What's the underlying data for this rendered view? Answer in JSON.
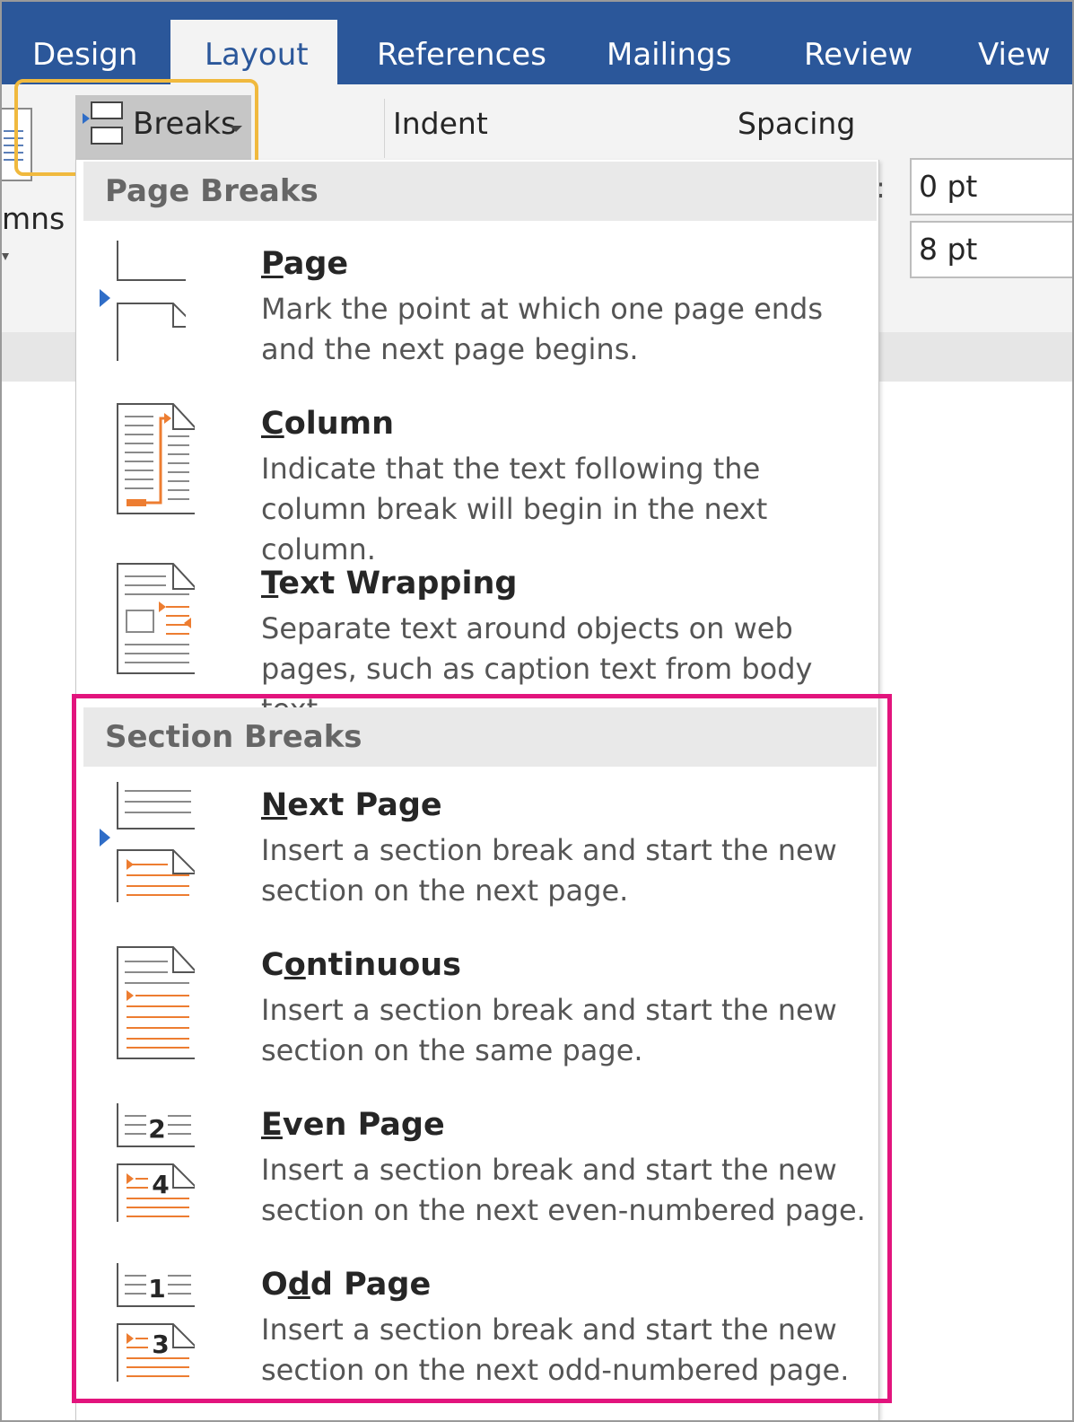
{
  "ribbon": {
    "tabs": [
      {
        "label": "Design",
        "active": false
      },
      {
        "label": "Layout",
        "active": true
      },
      {
        "label": "References",
        "active": false
      },
      {
        "label": "Mailings",
        "active": false
      },
      {
        "label": "Review",
        "active": false
      },
      {
        "label": "View",
        "active": false
      }
    ],
    "columns_label": "mns",
    "breaks_label": "Breaks",
    "indent_label": "Indent",
    "spacing_label": "Spacing",
    "spacing_before": "0 pt",
    "spacing_after": "8 pt"
  },
  "menu": {
    "page_breaks_header": "Page Breaks",
    "section_breaks_header": "Section Breaks",
    "items": [
      {
        "title": "Page",
        "access_key": "P",
        "desc": "Mark the point at which one page ends and the next page begins.",
        "icon": "page-break-icon"
      },
      {
        "title": "Column",
        "access_key": "C",
        "desc": "Indicate that the text following the column break will begin in the next column.",
        "icon": "column-break-icon"
      },
      {
        "title": "Text Wrapping",
        "access_key": "T",
        "desc": "Separate text around objects on web pages, such as caption text from body text.",
        "icon": "text-wrapping-icon"
      },
      {
        "title": "Next Page",
        "access_key": "N",
        "desc": "Insert a section break and start the new section on the next page.",
        "icon": "next-page-icon"
      },
      {
        "title": "Continuous",
        "access_key": "o",
        "desc": "Insert a section break and start the new section on the same page.",
        "icon": "continuous-icon"
      },
      {
        "title": "Even Page",
        "access_key": "E",
        "desc": "Insert a section break and start the new section on the next even-numbered page.",
        "icon": "even-page-icon"
      },
      {
        "title": "Odd Page",
        "access_key": "d",
        "desc": "Insert a section break and start the new section on the next odd-numbered page.",
        "icon": "odd-page-icon"
      }
    ]
  },
  "icon_numbers": {
    "even_top": "2",
    "even_bottom": "4",
    "odd_top": "1",
    "odd_bottom": "3"
  },
  "colors": {
    "ribbon_blue": "#2b579a",
    "highlight_yellow": "#f0b93e",
    "highlight_pink": "#e2147d",
    "icon_orange": "#ed7d31"
  }
}
